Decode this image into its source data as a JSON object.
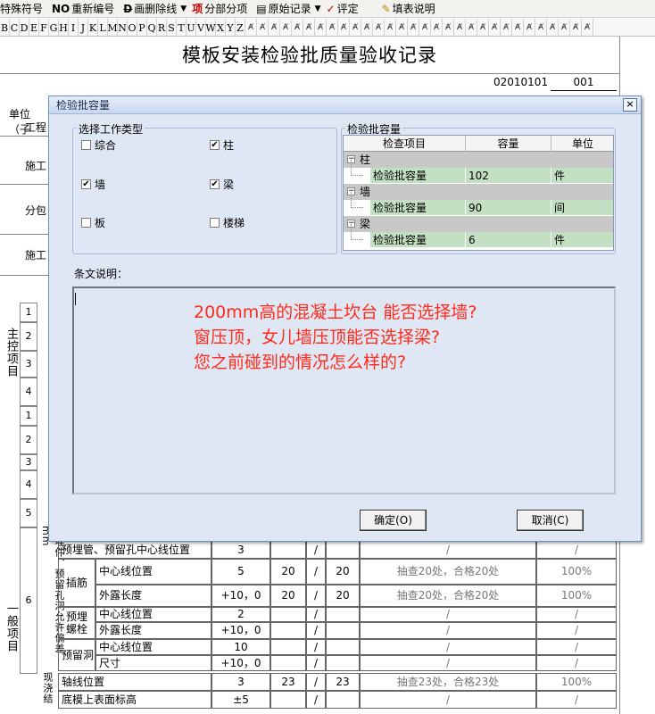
{
  "toolbar": {
    "items": [
      {
        "glyph": "",
        "label": "特殊符号"
      },
      {
        "glyph": "NO",
        "label": "重新编号"
      },
      {
        "glyph": "D",
        "label": "画删除线",
        "dropdown": true
      },
      {
        "glyph": "项",
        "label": "分部分项"
      },
      {
        "glyph": "",
        "label": "原始记录",
        "dropdown": true
      },
      {
        "glyph": "",
        "label": "评定"
      },
      {
        "glyph": "",
        "label": "填表说明"
      }
    ]
  },
  "fontbar": {
    "letters": [
      "B",
      "C",
      "D",
      "E",
      "F",
      "G",
      "H",
      "I",
      "J",
      "K",
      "L",
      "M",
      "N",
      "O",
      "P",
      "Q",
      "R",
      "S",
      "T",
      "U",
      "V",
      "W",
      "X",
      "Y",
      "Z"
    ]
  },
  "document": {
    "title": "模板安装检验批质量验收记录",
    "form_code": "02010101",
    "form_number": "001",
    "left_labels": [
      "单位（子",
      "工程",
      "施工",
      "分包",
      "施工"
    ],
    "main_control_label": "主控项目",
    "general_label": "一般项目",
    "main_rows": [
      "1",
      "2",
      "3",
      "4"
    ],
    "general_rows": [
      "1",
      "2",
      "3",
      "4",
      "5"
    ],
    "row6": "6",
    "embedded_label": "预埋件、预留孔洞允许偏差mm",
    "table": [
      {
        "sub": "预埋管、预留孔中心线位置",
        "group": "",
        "item": "",
        "tol": "3",
        "n1": "",
        "n2": "",
        "result": "/",
        "ok": "/"
      },
      {
        "sub": "插筋",
        "group": "",
        "item": "中心线位置",
        "tol": "5",
        "n1": "20",
        "n2": "20",
        "result": "抽查20处，合格20处",
        "ok": "100%"
      },
      {
        "sub": "",
        "group": "",
        "item": "外露长度",
        "tol": "+10，0",
        "n1": "20",
        "n2": "20",
        "result": "抽查20处，合格20处",
        "ok": "100%"
      },
      {
        "sub": "预埋螺栓",
        "group": "",
        "item": "中心线位置",
        "tol": "2",
        "n1": "",
        "n2": "",
        "result": "/",
        "ok": "/"
      },
      {
        "sub": "",
        "group": "",
        "item": "外露长度",
        "tol": "+10，0",
        "n1": "",
        "n2": "",
        "result": "/",
        "ok": "/"
      },
      {
        "sub": "预留洞",
        "group": "",
        "item": "中心线位置",
        "tol": "10",
        "n1": "",
        "n2": "",
        "result": "/",
        "ok": "/"
      },
      {
        "sub": "",
        "group": "",
        "item": "尺寸",
        "tol": "+10，0",
        "n1": "",
        "n2": "",
        "result": "/",
        "ok": "/"
      }
    ],
    "cast_label": "现浇结",
    "cast_rows": [
      {
        "item": "轴线位置",
        "tol": "3",
        "n1": "23",
        "n2": "23",
        "result": "抽查23处，合格23处",
        "ok": "100%"
      },
      {
        "item": "底模上表面标高",
        "tol": "±5",
        "n1": "",
        "n2": "",
        "result": "/",
        "ok": "/"
      }
    ],
    "slash": "/"
  },
  "dialog": {
    "title": "检验批容量",
    "close": "×",
    "work_type_legend": "选择工作类型",
    "work_types": [
      {
        "label": "综合",
        "checked": false
      },
      {
        "label": "柱",
        "checked": true
      },
      {
        "label": "墙",
        "checked": true
      },
      {
        "label": "梁",
        "checked": true
      },
      {
        "label": "板",
        "checked": false
      },
      {
        "label": "楼梯",
        "checked": false
      }
    ],
    "capacity_legend": "检验批容量",
    "grid_headers": [
      "检查项目",
      "容量",
      "单位"
    ],
    "grid_groups": [
      {
        "name": "柱",
        "item": "检验批容量",
        "capacity": "102",
        "unit": "件"
      },
      {
        "name": "墙",
        "item": "检验批容量",
        "capacity": "90",
        "unit": "间"
      },
      {
        "name": "梁",
        "item": "检验批容量",
        "capacity": "6",
        "unit": "件"
      }
    ],
    "note_label": "条文说明：",
    "note_lines": [
      "200mm高的混凝土坎台 能否选择墙?",
      "窗压顶，女儿墙压顶能否选择梁?",
      "您之前碰到的情况怎么样的?"
    ],
    "ok_button": "确定(O)",
    "cancel_button": "取消(C)"
  }
}
